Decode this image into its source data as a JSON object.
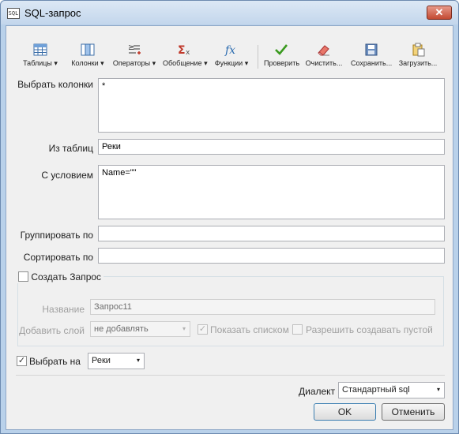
{
  "window": {
    "title": "SQL-запрос",
    "icon": "sql-file-icon",
    "close_glyph": "✕"
  },
  "toolbar": {
    "items": [
      {
        "label": "Таблицы",
        "icon": "table-icon",
        "dropdown": true
      },
      {
        "label": "Колонки",
        "icon": "columns-icon",
        "dropdown": true
      },
      {
        "label": "Операторы",
        "icon": "operators-icon",
        "dropdown": true
      },
      {
        "label": "Обобщение",
        "icon": "sigma-icon",
        "dropdown": true
      },
      {
        "label": "Функции",
        "icon": "fx-icon",
        "dropdown": true
      },
      {
        "label": "Проверить",
        "icon": "checkmark-icon",
        "dropdown": false
      },
      {
        "label": "Очистить...",
        "icon": "eraser-icon",
        "dropdown": false
      },
      {
        "label": "Сохранить...",
        "icon": "save-icon",
        "dropdown": false
      },
      {
        "label": "Загрузить...",
        "icon": "load-icon",
        "dropdown": false
      }
    ],
    "dropdown_glyph": "▾"
  },
  "form": {
    "select_columns": {
      "label": "Выбрать колонки",
      "value": "*"
    },
    "from_tables": {
      "label": "Из таблиц",
      "value": "Реки"
    },
    "where": {
      "label": "С условием",
      "value": "Name=\"\""
    },
    "group_by": {
      "label": "Группировать по",
      "value": ""
    },
    "order_by": {
      "label": "Сортировать по",
      "value": ""
    }
  },
  "create_query": {
    "label": "Создать Запрос",
    "checked": false,
    "name_label": "Название",
    "name_value": "Запрос11",
    "add_layer_label": "Добавить слой",
    "add_layer_value": "не добавлять",
    "show_list_label": "Показать списком",
    "show_list_checked": true,
    "allow_empty_label": "Разрешить создавать пустой",
    "allow_empty_checked": false
  },
  "select_on": {
    "label": "Выбрать на",
    "checked": true,
    "value": "Реки"
  },
  "dialect": {
    "label": "Диалект",
    "value": "Стандартный sql"
  },
  "buttons": {
    "ok": "OK",
    "cancel": "Отменить"
  },
  "check_glyph": "✓",
  "colors": {
    "title_gradient_top": "#dce8f5",
    "close_red": "#c34a32",
    "check_green": "#3a9a1f",
    "sigma_red": "#c0392b",
    "fx_blue": "#2b6cb0"
  }
}
